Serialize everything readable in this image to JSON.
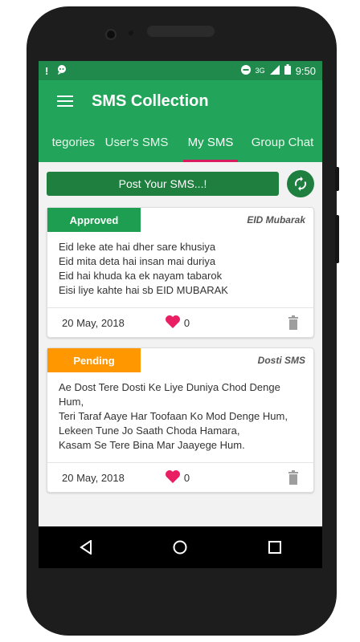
{
  "status": {
    "time": "9:50",
    "network": "3G"
  },
  "app": {
    "title": "SMS Collection"
  },
  "tabs": [
    {
      "label": "tegories"
    },
    {
      "label": "User's SMS"
    },
    {
      "label": "My SMS"
    },
    {
      "label": "Group Chat"
    }
  ],
  "post": {
    "label": "Post Your SMS...!"
  },
  "cards": [
    {
      "status": "Approved",
      "status_color": "#1e9e50",
      "category": "EID Mubarak",
      "text": "Eid leke ate hai dher sare khusiya\nEid mita deta hai insan mai duriya\nEid hai khuda ka ek nayam tabarok\nEisi liye kahte hai sb EID MUBARAK",
      "date": "20 May, 2018",
      "likes": "0"
    },
    {
      "status": "Pending",
      "status_color": "#ff9800",
      "category": "Dosti SMS",
      "text": "Ae Dost Tere Dosti Ke Liye Duniya Chod Denge Hum,\nTeri Taraf Aaye Har Toofaan Ko Mod Denge Hum,\nLekeen Tune Jo Saath Choda Hamara,\nKasam Se Tere Bina Mar Jaayege Hum.",
      "date": "20 May, 2018",
      "likes": "0"
    }
  ],
  "colors": {
    "primary": "#22a55a",
    "primary_dark": "#1f8a4c",
    "button": "#1e7f3f",
    "indicator": "#d81b60",
    "heart": "#e91e63"
  }
}
